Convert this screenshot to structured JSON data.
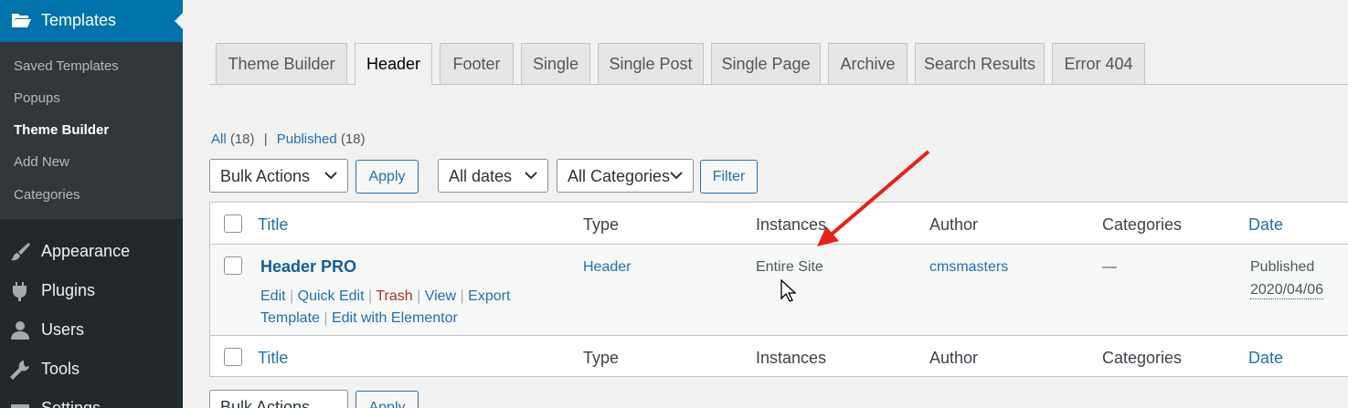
{
  "sidebar": {
    "top_item": {
      "label": "Templates",
      "icon": "folder-open-icon"
    },
    "submenu": [
      {
        "label": "Saved Templates",
        "current": false
      },
      {
        "label": "Popups",
        "current": false
      },
      {
        "label": "Theme Builder",
        "current": true
      },
      {
        "label": "Add New",
        "current": false
      },
      {
        "label": "Categories",
        "current": false
      }
    ],
    "items": [
      {
        "label": "Appearance",
        "icon": "paintbrush-icon"
      },
      {
        "label": "Plugins",
        "icon": "plugin-icon"
      },
      {
        "label": "Users",
        "icon": "users-icon"
      },
      {
        "label": "Tools",
        "icon": "wrench-icon"
      },
      {
        "label": "Settings",
        "icon": "settings-icon"
      }
    ]
  },
  "tabs": [
    "Theme Builder",
    "Header",
    "Footer",
    "Single",
    "Single Post",
    "Single Page",
    "Archive",
    "Search Results",
    "Error 404"
  ],
  "active_tab": "Header",
  "views": {
    "all_label": "All",
    "all_count": "(18)",
    "separator": "|",
    "published_label": "Published",
    "published_count": "(18)"
  },
  "filters": {
    "bulk_actions": "Bulk Actions",
    "apply": "Apply",
    "dates": "All dates",
    "categories": "All Categories",
    "filter": "Filter"
  },
  "table": {
    "columns": [
      "Title",
      "Type",
      "Instances",
      "Author",
      "Categories",
      "Date"
    ],
    "rows": [
      {
        "title": "Header PRO",
        "actions": [
          "Edit",
          "Quick Edit",
          "Trash",
          "View",
          "Export Template",
          "Edit with Elementor"
        ],
        "type": "Header",
        "instances": "Entire Site",
        "author": "cmsmasters",
        "categories": "—",
        "date_status": "Published",
        "date": "2020/04/06"
      }
    ]
  },
  "colors": {
    "accent": "#0073aa",
    "link": "#2271b1",
    "sidebar_bg": "#23282d",
    "trash": "#b32d2e",
    "annotation_arrow": "#e2231a"
  }
}
